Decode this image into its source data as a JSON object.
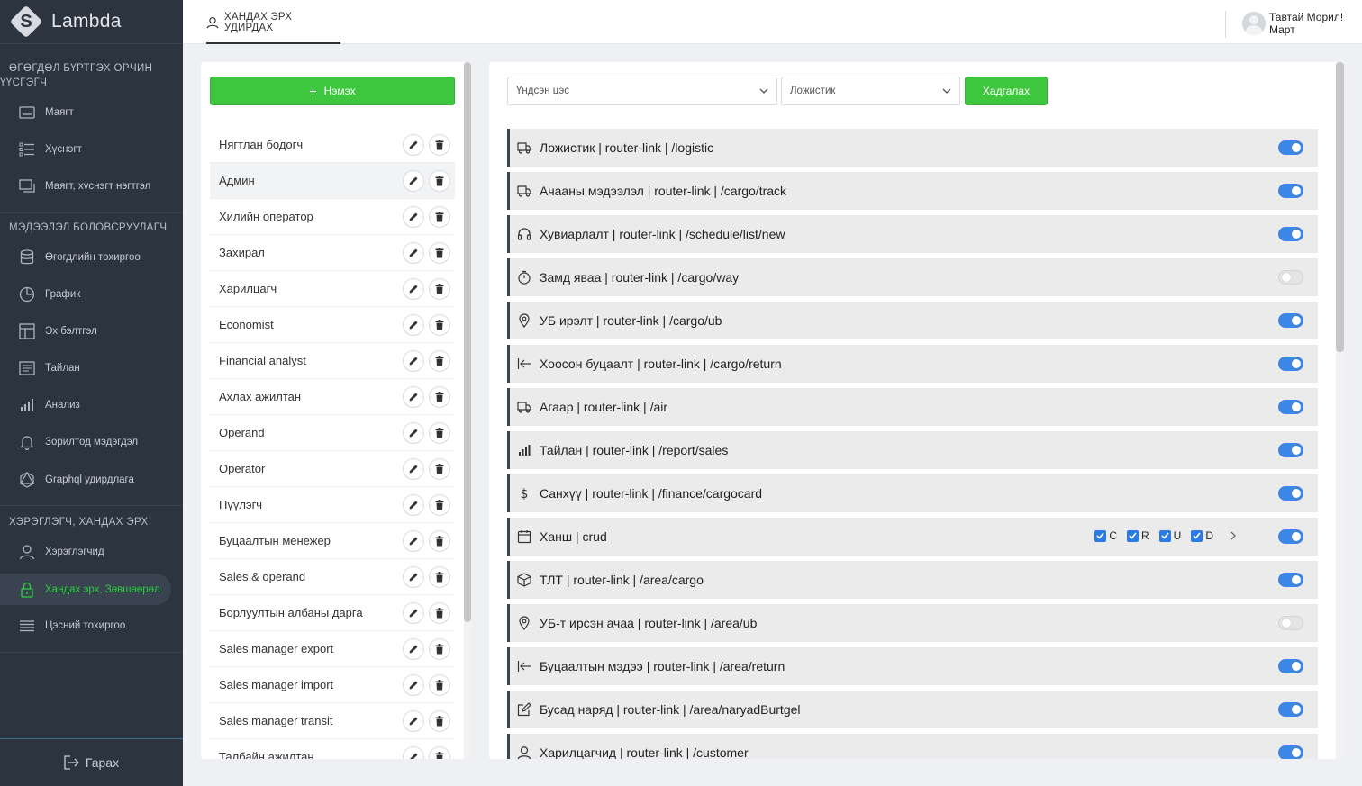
{
  "app": {
    "name": "Lambda"
  },
  "sidebar": {
    "section1": {
      "title_line1": "ӨГӨГДӨЛ БҮРТГЭХ ОРЧИН",
      "title_line2": "ҮҮСГЭГЧ"
    },
    "section2": {
      "title": "МЭДЭЭЛЭЛ БОЛОВСРУУЛАГЧ"
    },
    "section3": {
      "title": "ХЭРЭГЛЭГЧ, ХАНДАХ ЭРХ"
    },
    "items": [
      {
        "label": "Маягт",
        "icon": "form-icon"
      },
      {
        "label": "Хүснэгт",
        "icon": "table-list-icon"
      },
      {
        "label": "Маягт, хүснэгт нэгтгэл",
        "icon": "combine-icon"
      },
      {
        "label": "Өгөгдлийн тохиргоо",
        "icon": "database-icon"
      },
      {
        "label": "График",
        "icon": "pie-chart-icon"
      },
      {
        "label": "Эх бэлтгэл",
        "icon": "layout-icon"
      },
      {
        "label": "Тайлан",
        "icon": "report-icon"
      },
      {
        "label": "Анализ",
        "icon": "bar-chart-icon"
      },
      {
        "label": "Зорилтод мэдэгдэл",
        "icon": "bell-icon"
      },
      {
        "label": "Graphql удирдлага",
        "icon": "graphql-icon"
      },
      {
        "label": "Хэрэглэгчид",
        "icon": "user-icon"
      },
      {
        "label": "Хандах эрх, Зөвшөөрөл",
        "icon": "lock-icon",
        "active": true
      },
      {
        "label": "Цэсний тохиргоо",
        "icon": "menu-icon"
      }
    ],
    "logout": "Гарах"
  },
  "header": {
    "tab_label": "ХАНДАХ ЭРХ УДИРДАХ",
    "user_greeting": "Тавтай Морил!",
    "user_name": "Март"
  },
  "roles": {
    "add_label": "Нэмэх",
    "items": [
      "Нягтлан бодогч",
      "Админ",
      "Хилийн оператор",
      "Захирал",
      "Харилцагч",
      "Economist",
      "Financial analyst",
      "Ахлах ажилтан",
      "Operand",
      "Operator",
      "Пүүлэгч",
      "Буцаалтын менежер",
      "Sales & operand",
      "Борлуултын албаны дарга",
      "Sales manager export",
      "Sales manager import",
      "Sales manager transit",
      "Талбайн ажилтан"
    ],
    "selected_index": 1
  },
  "permissions": {
    "main_menu_placeholder": "Үндсэн цэс",
    "sub_menu_value": "Ложистик",
    "save_label": "Хадгалах",
    "crud_labels": [
      "C",
      "R",
      "U",
      "D"
    ],
    "items": [
      {
        "label": "Ложистик | router-link | /logistic",
        "icon": "truck-icon",
        "enabled": true
      },
      {
        "label": "Ачааны мэдээлэл | router-link | /cargo/track",
        "icon": "truck-icon",
        "enabled": true
      },
      {
        "label": "Хувиарлалт | router-link | /schedule/list/new",
        "icon": "headset-icon",
        "enabled": true
      },
      {
        "label": "Замд яваа | router-link | /cargo/way",
        "icon": "timer-icon",
        "enabled": false
      },
      {
        "label": "УБ ирэлт | router-link | /cargo/ub",
        "icon": "location-pin-icon",
        "enabled": true
      },
      {
        "label": "Хоосон буцаалт | router-link | /cargo/return",
        "icon": "arrow-left-bar-icon",
        "enabled": true
      },
      {
        "label": "Агаар | router-link | /air",
        "icon": "truck-icon",
        "enabled": true
      },
      {
        "label": "Тайлан | router-link | /report/sales",
        "icon": "bar-chart-icon",
        "enabled": true
      },
      {
        "label": "Санхүү | router-link | /finance/cargocard",
        "icon": "dollar-icon",
        "enabled": true
      },
      {
        "label": "Ханш | crud",
        "icon": "calendar-icon",
        "enabled": true,
        "crud": true
      },
      {
        "label": "ТЛТ | router-link | /area/cargo",
        "icon": "box-icon",
        "enabled": true
      },
      {
        "label": "УБ-т ирсэн ачаа | router-link | /area/ub",
        "icon": "location-pin-icon",
        "enabled": false
      },
      {
        "label": "Буцаалтын мэдээ | router-link | /area/return",
        "icon": "arrow-left-bar-icon",
        "enabled": true
      },
      {
        "label": "Бусад наряд | router-link | /area/naryadBurtgel",
        "icon": "edit-icon",
        "enabled": true
      },
      {
        "label": "Харилцагчид | router-link | /customer",
        "icon": "user-icon",
        "enabled": true
      }
    ]
  },
  "colors": {
    "sidebar_bg": "#2c3440",
    "accent_green": "#3fc63f",
    "toggle_blue": "#3d86e6",
    "active_text": "#2ecc40"
  }
}
